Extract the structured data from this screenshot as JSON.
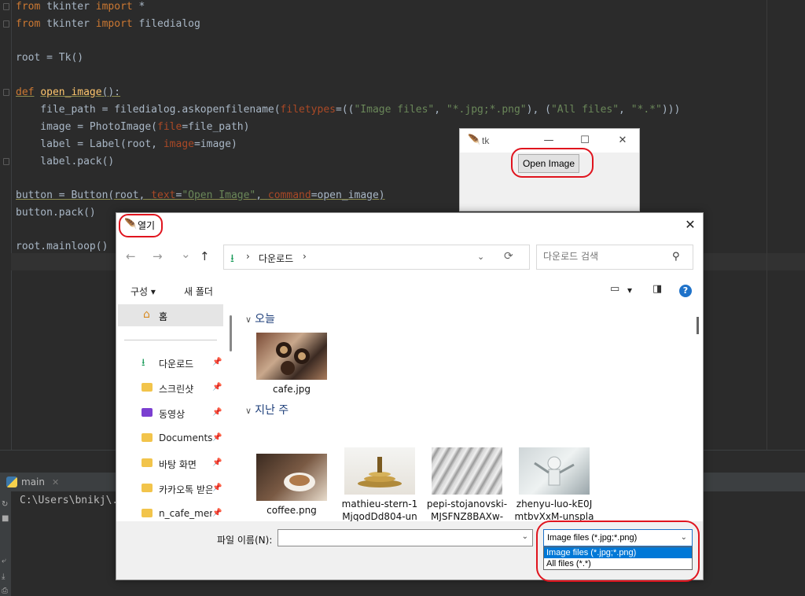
{
  "editor": {
    "lines": {
      "l1": {
        "kw": "from",
        "rest": " tkinter ",
        "kw2": "import",
        "rest2": " *"
      },
      "l2": {
        "kw": "from",
        "rest": " tkinter ",
        "kw2": "import",
        "rest2": " filedialog"
      },
      "l4": "root = Tk()",
      "l6": {
        "kw": "def",
        "fn": "open_image",
        "rest": "():"
      },
      "l7": {
        "a": "    file_path = filedialog.askopenfilename(",
        "p": "filetypes",
        "b": "=((",
        "s1": "\"Image files\"",
        "c": ", ",
        "s2": "\"*.jpg;*.png\"",
        "d": "), (",
        "s3": "\"All files\"",
        "e": ", ",
        "s4": "\"*.*\"",
        "f": ")))"
      },
      "l8": {
        "a": "    image = PhotoImage(",
        "p": "file",
        "b": "=file_path)"
      },
      "l9": {
        "a": "    label = Label(root, ",
        "p": "image",
        "b": "=image)"
      },
      "l10": "    label.pack()",
      "l12": {
        "a": "button = Button(root, ",
        "p": "text",
        "b": "=",
        "s": "\"Open Image\"",
        "c": ", ",
        "p2": "command",
        "d": "=open_image)"
      },
      "l13": "button.pack()",
      "l15": "root.mainloop()"
    }
  },
  "run_panel": {
    "tab_label": "main",
    "console_text": "C:\\Users\\bnikj\\."
  },
  "tk_window": {
    "title": "tk",
    "minimize": "—",
    "maximize": "☐",
    "close": "✕",
    "button_label": "Open Image"
  },
  "dialog": {
    "title": "열기",
    "close": "✕",
    "nav": {
      "back": "←",
      "forward": "→",
      "recent": "⌄",
      "up": "↑"
    },
    "address": {
      "separator1": "›",
      "crumb": "다운로드",
      "separator2": "›",
      "dropdown": "⌄",
      "refresh": "⟳"
    },
    "search_placeholder": "다운로드 검색",
    "toolbar": {
      "organize": "구성 ▾",
      "new_folder": "새 폴더",
      "view_dropdown": "▾"
    },
    "nav_pane": {
      "home": "홈",
      "items": [
        {
          "label": "다운로드",
          "pin": "📌"
        },
        {
          "label": "스크린샷",
          "pin": "📌"
        },
        {
          "label": "동영상",
          "pin": "📌"
        },
        {
          "label": "Documents",
          "pin": "📌"
        },
        {
          "label": "바탕 화면",
          "pin": "📌"
        },
        {
          "label": "카카오톡 받은",
          "pin": "📌"
        },
        {
          "label": "n_cafe_mem",
          "pin": "📌"
        }
      ]
    },
    "groups": {
      "today": {
        "header": "오늘",
        "files": [
          {
            "name": "cafe.jpg"
          }
        ]
      },
      "last_week": {
        "header": "지난 주",
        "files": [
          {
            "line1": "coffee.png",
            "line2": ""
          },
          {
            "line1": "mathieu-stern-1",
            "line2": "MjqodDd804-un"
          },
          {
            "line1": "pepi-stojanovski-",
            "line2": "MJSFNZ8BAXw-"
          },
          {
            "line1": "zhenyu-luo-kE0J",
            "line2": "mtbvXxM-unspla"
          }
        ]
      }
    },
    "bottom": {
      "filename_label": "파일 이름(N):",
      "filename_value": "",
      "filter_selected": "Image files (*.jpg;*.png)",
      "filter_options": [
        "Image files (*.jpg;*.png)",
        "All files (*.*)"
      ]
    }
  },
  "colors": {
    "annotation_red": "#e0141e",
    "accent_blue": "#0078d7",
    "ide_bg": "#2b2b2b"
  }
}
